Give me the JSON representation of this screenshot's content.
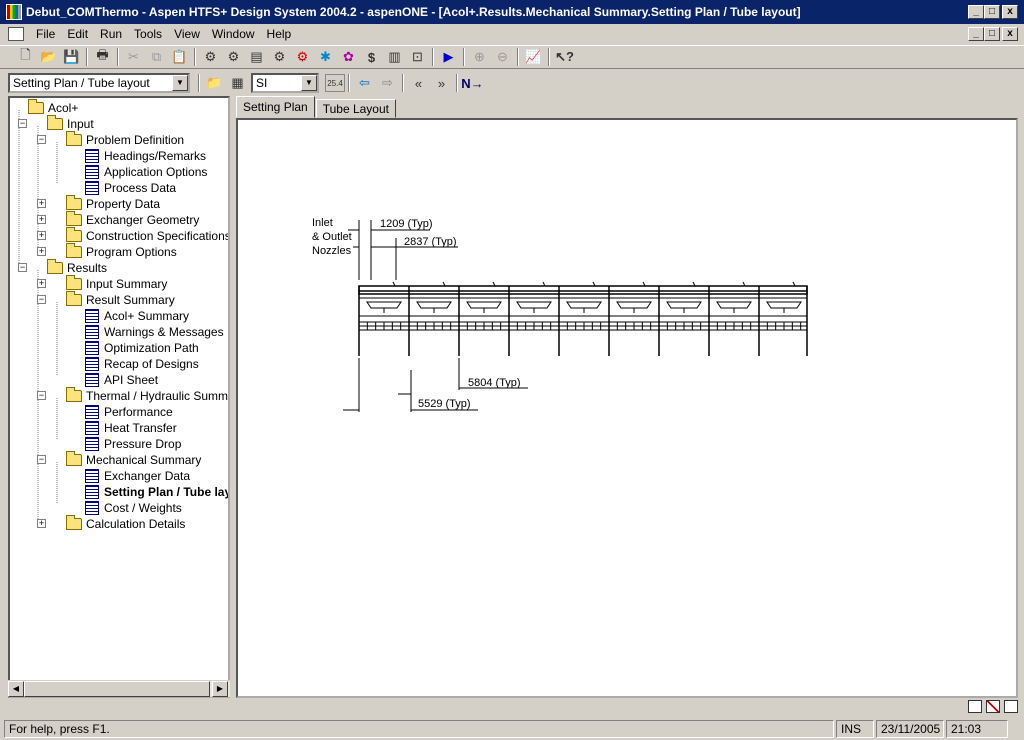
{
  "window": {
    "title": "Debut_COMThermo - Aspen HTFS+ Design System 2004.2 - aspenONE - [Acol+.Results.Mechanical Summary.Setting Plan / Tube layout]",
    "minimize": "_",
    "restore": "□",
    "close": "x"
  },
  "menu": {
    "items": [
      {
        "label": "File"
      },
      {
        "label": "Edit"
      },
      {
        "label": "Run"
      },
      {
        "label": "Tools"
      },
      {
        "label": "View"
      },
      {
        "label": "Window"
      },
      {
        "label": "Help"
      }
    ]
  },
  "toolbar2": {
    "view_combo": "Setting Plan / Tube layout",
    "units_combo": "SI",
    "units_conv": "25.4"
  },
  "tree": {
    "rows": [
      {
        "label": "Acol+",
        "level": 0,
        "icon": "folder-icon",
        "expander": ""
      },
      {
        "label": "Input",
        "level": 1,
        "icon": "folder-icon",
        "expander": "−"
      },
      {
        "label": "Problem Definition",
        "level": 2,
        "icon": "folder-icon",
        "expander": "−"
      },
      {
        "label": "Headings/Remarks",
        "level": 3,
        "icon": "form-icon",
        "expander": ""
      },
      {
        "label": "Application Options",
        "level": 3,
        "icon": "form-icon",
        "expander": ""
      },
      {
        "label": "Process Data",
        "level": 3,
        "icon": "form-icon",
        "expander": ""
      },
      {
        "label": "Property Data",
        "level": 2,
        "icon": "folder-icon",
        "expander": "+"
      },
      {
        "label": "Exchanger Geometry",
        "level": 2,
        "icon": "folder-icon",
        "expander": "+"
      },
      {
        "label": "Construction Specifications",
        "level": 2,
        "icon": "folder-icon",
        "expander": "+"
      },
      {
        "label": "Program Options",
        "level": 2,
        "icon": "folder-icon",
        "expander": "+"
      },
      {
        "label": "Results",
        "level": 1,
        "icon": "folder-icon",
        "expander": "−"
      },
      {
        "label": "Input Summary",
        "level": 2,
        "icon": "folder-icon",
        "expander": "+"
      },
      {
        "label": "Result Summary",
        "level": 2,
        "icon": "folder-icon",
        "expander": "−"
      },
      {
        "label": "Acol+ Summary",
        "level": 3,
        "icon": "form-icon",
        "expander": ""
      },
      {
        "label": "Warnings & Messages",
        "level": 3,
        "icon": "form-icon",
        "expander": ""
      },
      {
        "label": "Optimization Path",
        "level": 3,
        "icon": "form-icon",
        "expander": ""
      },
      {
        "label": "Recap of Designs",
        "level": 3,
        "icon": "form-icon",
        "expander": ""
      },
      {
        "label": "API Sheet",
        "level": 3,
        "icon": "form-icon",
        "expander": ""
      },
      {
        "label": "Thermal / Hydraulic Summary",
        "level": 2,
        "icon": "folder-icon",
        "expander": "−"
      },
      {
        "label": "Performance",
        "level": 3,
        "icon": "form-icon",
        "expander": ""
      },
      {
        "label": "Heat Transfer",
        "level": 3,
        "icon": "form-icon",
        "expander": ""
      },
      {
        "label": "Pressure Drop",
        "level": 3,
        "icon": "form-icon",
        "expander": ""
      },
      {
        "label": "Mechanical Summary",
        "level": 2,
        "icon": "folder-icon",
        "expander": "−"
      },
      {
        "label": "Exchanger Data",
        "level": 3,
        "icon": "form-icon",
        "expander": ""
      },
      {
        "label": "Setting Plan / Tube layo",
        "level": 3,
        "icon": "form-icon",
        "expander": "",
        "selected": true
      },
      {
        "label": "Cost / Weights",
        "level": 3,
        "icon": "form-icon",
        "expander": ""
      },
      {
        "label": "Calculation Details",
        "level": 2,
        "icon": "folder-icon",
        "expander": "+"
      }
    ]
  },
  "tabs": [
    {
      "label": "Setting Plan",
      "active": true
    },
    {
      "label": "Tube Layout",
      "active": false
    }
  ],
  "drawing": {
    "inlet_label_1": "Inlet",
    "inlet_label_2": "& Outlet",
    "inlet_label_3": "Nozzles",
    "dim_1": "1209 (Typ)",
    "dim_2": "2837 (Typ)",
    "dim_3": "5804 (Typ)",
    "dim_4": "5529 (Typ)"
  },
  "status": {
    "help": "For help, press F1.",
    "mode": "INS",
    "date": "23/11/2005",
    "time": "21:03"
  }
}
